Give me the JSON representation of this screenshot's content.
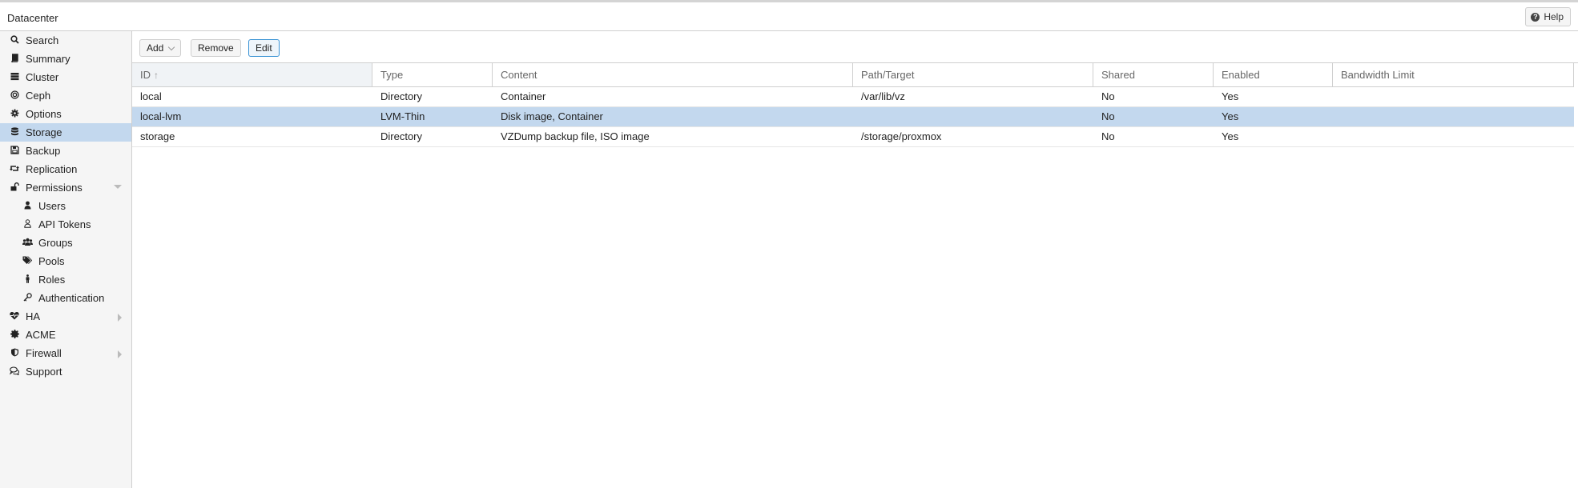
{
  "header": {
    "title": "Datacenter",
    "help_label": "Help"
  },
  "sidebar": {
    "items": [
      {
        "label": "Search",
        "icon": "search-icon"
      },
      {
        "label": "Summary",
        "icon": "book-icon"
      },
      {
        "label": "Cluster",
        "icon": "server-icon"
      },
      {
        "label": "Ceph",
        "icon": "ceph-icon"
      },
      {
        "label": "Options",
        "icon": "gear-icon"
      },
      {
        "label": "Storage",
        "icon": "database-icon",
        "selected": true
      },
      {
        "label": "Backup",
        "icon": "floppy-icon"
      },
      {
        "label": "Replication",
        "icon": "retweet-icon"
      },
      {
        "label": "Permissions",
        "icon": "unlock-icon",
        "expanded": true
      },
      {
        "label": "Users",
        "icon": "user-icon"
      },
      {
        "label": "API Tokens",
        "icon": "user-outline-icon"
      },
      {
        "label": "Groups",
        "icon": "users-icon"
      },
      {
        "label": "Pools",
        "icon": "tags-icon"
      },
      {
        "label": "Roles",
        "icon": "male-icon"
      },
      {
        "label": "Authentication",
        "icon": "key-icon"
      },
      {
        "label": "HA",
        "icon": "heartbeat-icon",
        "collapsed": true
      },
      {
        "label": "ACME",
        "icon": "certificate-icon"
      },
      {
        "label": "Firewall",
        "icon": "shield-icon",
        "collapsed": true
      },
      {
        "label": "Support",
        "icon": "comments-icon"
      }
    ]
  },
  "toolbar": {
    "add_label": "Add",
    "remove_label": "Remove",
    "edit_label": "Edit"
  },
  "grid": {
    "columns": [
      "ID",
      "Type",
      "Content",
      "Path/Target",
      "Shared",
      "Enabled",
      "Bandwidth Limit"
    ],
    "sort_indicator": "↑",
    "rows": [
      {
        "id": "local",
        "type": "Directory",
        "content": "Container",
        "path": "/var/lib/vz",
        "shared": "No",
        "enabled": "Yes",
        "bandwidth": ""
      },
      {
        "id": "local-lvm",
        "type": "LVM-Thin",
        "content": "Disk image, Container",
        "path": "",
        "shared": "No",
        "enabled": "Yes",
        "bandwidth": "",
        "selected": true
      },
      {
        "id": "storage",
        "type": "Directory",
        "content": "VZDump backup file, ISO image",
        "path": "/storage/proxmox",
        "shared": "No",
        "enabled": "Yes",
        "bandwidth": ""
      }
    ]
  },
  "colors": {
    "selection": "#c3d8ee",
    "sidebar_bg": "#f5f5f5",
    "border": "#cfcfcf"
  }
}
